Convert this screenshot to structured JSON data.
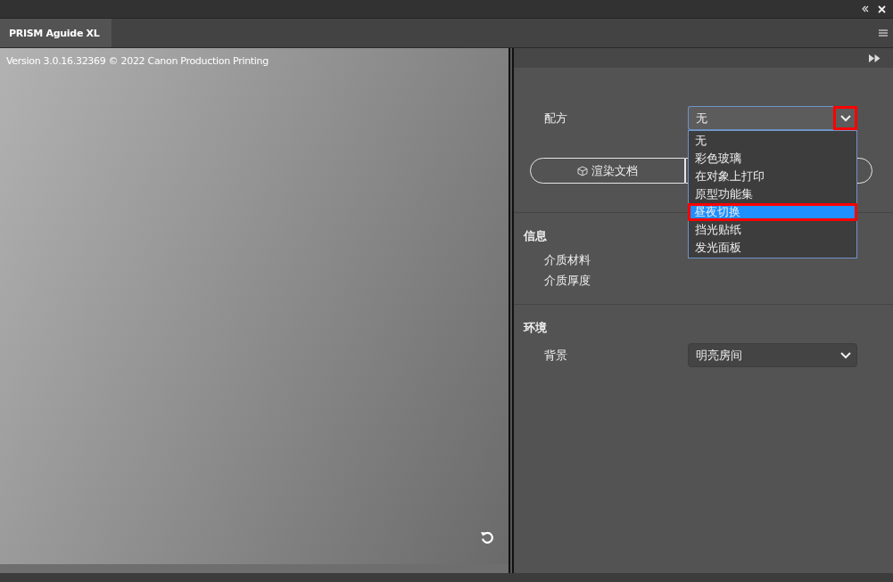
{
  "tab": {
    "label": "PRISM Aguide XL",
    "selected": true
  },
  "preview": {
    "version": "Version 3.0.16.32369 © 2022 Canon Production Printing"
  },
  "recipe": {
    "label": "配方",
    "value": "无",
    "expanded": true,
    "options": [
      {
        "label": "无",
        "highlighted": false
      },
      {
        "label": "彩色玻璃",
        "highlighted": false
      },
      {
        "label": "在对象上打印",
        "highlighted": false
      },
      {
        "label": "原型功能集",
        "highlighted": false
      },
      {
        "label": "昼夜切换",
        "highlighted": true
      },
      {
        "label": "挡光贴纸",
        "highlighted": false
      },
      {
        "label": "发光面板",
        "highlighted": false
      }
    ]
  },
  "render_button": {
    "label": "渲染文档"
  },
  "info": {
    "title": "信息",
    "items": [
      "介质材料",
      "介质厚度"
    ]
  },
  "environment": {
    "title": "环境",
    "background": {
      "label": "背景",
      "value": "明亮房间"
    }
  }
}
